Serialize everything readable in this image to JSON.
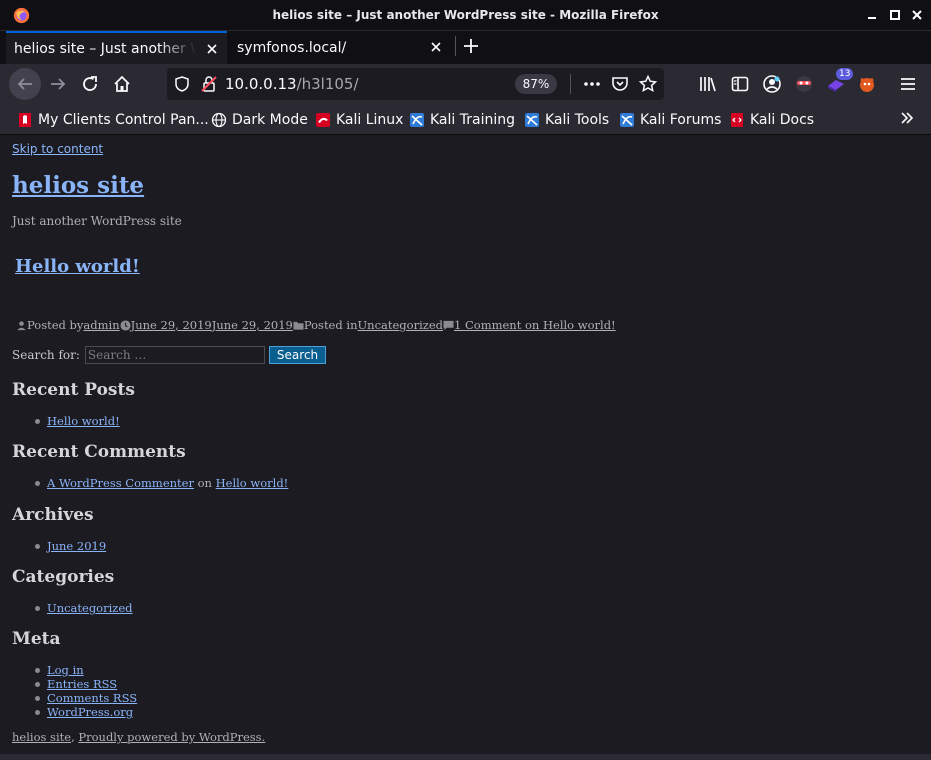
{
  "window": {
    "title": "helios site – Just another WordPress site - Mozilla Firefox"
  },
  "tabs": [
    {
      "label": "helios site – Just another WordPress site",
      "active": true
    },
    {
      "label": "symfonos.local/",
      "active": false
    }
  ],
  "navbar": {
    "url_host": "10.0.0.13",
    "url_path": "/h3l105/",
    "zoom": "87%",
    "extension_badge": "13"
  },
  "bookmarks": [
    {
      "label": "My Clients Control Pan...",
      "icon": "red-book-icon"
    },
    {
      "label": "Dark Mode",
      "icon": "globe-icon"
    },
    {
      "label": "Kali Linux",
      "icon": "kali-icon"
    },
    {
      "label": "Kali Training",
      "icon": "kali-icon"
    },
    {
      "label": "Kali Tools",
      "icon": "kali-icon"
    },
    {
      "label": "Kali Forums",
      "icon": "kali-icon"
    },
    {
      "label": "Kali Docs",
      "icon": "kali-docs-icon"
    }
  ],
  "page": {
    "skip_link": "Skip to content",
    "site_title": "helios site",
    "site_description": "Just another WordPress site",
    "post": {
      "title": "Hello world!",
      "posted_by": "Posted by",
      "author": "admin",
      "date_published": "June 29, 2019",
      "date_updated": "June 29, 2019",
      "posted_in": "Posted in",
      "category": "Uncategorized",
      "comments": "1 Comment on Hello world!"
    },
    "search": {
      "label": "Search for:",
      "placeholder": "Search …",
      "button": "Search"
    },
    "widgets": {
      "recent_posts": {
        "title": "Recent Posts",
        "items": [
          "Hello world!"
        ]
      },
      "recent_comments": {
        "title": "Recent Comments",
        "commenter": "A WordPress Commenter",
        "on": "on",
        "post": "Hello world!"
      },
      "archives": {
        "title": "Archives",
        "items": [
          "June 2019"
        ]
      },
      "categories": {
        "title": "Categories",
        "items": [
          "Uncategorized"
        ]
      },
      "meta": {
        "title": "Meta",
        "items": [
          "Log in",
          "Entries RSS",
          "Comments RSS",
          "WordPress.org"
        ]
      }
    },
    "footer": {
      "site_link": "helios site",
      "separator": ",",
      "powered": "Proudly powered by WordPress."
    }
  }
}
